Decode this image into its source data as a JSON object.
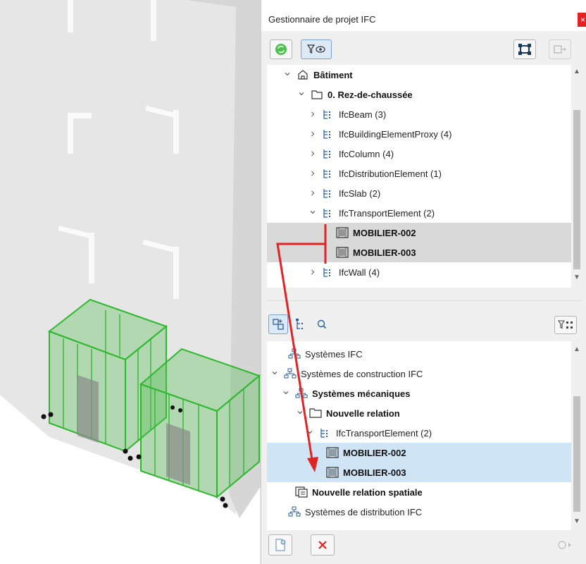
{
  "window": {
    "title": "Gestionnaire de projet IFC",
    "close_glyph": "×"
  },
  "top_toolbar": {
    "refresh_icon": "refresh-icon",
    "filter_view_icon": "filter-eye-icon",
    "structure_icon": "selection-frame-icon",
    "disabled_icon": "frame-arrow-icon"
  },
  "spatial_tree": {
    "items": [
      {
        "label": "Bâtiment",
        "bold": true,
        "expanded": true,
        "icon": "building-icon"
      },
      {
        "label": "0. Rez-de-chaussée",
        "bold": true,
        "expanded": true,
        "icon": "storey-icon"
      },
      {
        "label": "IfcBeam (3)",
        "icon": "ifc-type-icon"
      },
      {
        "label": "IfcBuildingElementProxy (4)",
        "icon": "ifc-type-icon"
      },
      {
        "label": "IfcColumn (4)",
        "icon": "ifc-type-icon"
      },
      {
        "label": "IfcDistributionElement (1)",
        "icon": "ifc-type-icon"
      },
      {
        "label": "IfcSlab (2)",
        "icon": "ifc-type-icon"
      },
      {
        "label": "IfcTransportElement (2)",
        "expanded": true,
        "icon": "ifc-type-icon"
      },
      {
        "label": "MOBILIER-002",
        "bold": true,
        "selected": true,
        "icon": "element-icon"
      },
      {
        "label": "MOBILIER-003",
        "bold": true,
        "selected": true,
        "icon": "element-icon"
      },
      {
        "label": "IfcWall (4)",
        "icon": "ifc-type-icon"
      }
    ]
  },
  "bottom_toolbar": {
    "add_icon": "add-assignment-icon",
    "hierarchy_icon": "hierarchy-icon",
    "search_icon": "search-icon",
    "filter_icon": "filter-icon"
  },
  "systems_tree": {
    "items": [
      {
        "label": "Systèmes IFC",
        "icon": "systems-icon"
      },
      {
        "label": "Systèmes de construction IFC",
        "expanded": true,
        "icon": "systems-icon"
      },
      {
        "label": "Systèmes mécaniques",
        "bold": true,
        "expanded": true,
        "icon": "systems-icon"
      },
      {
        "label": "Nouvelle relation",
        "bold": true,
        "expanded": true,
        "icon": "folder-icon"
      },
      {
        "label": "IfcTransportElement (2)",
        "expanded": true,
        "icon": "ifc-type-icon"
      },
      {
        "label": "MOBILIER-002",
        "bold": true,
        "selected": true,
        "icon": "element-icon"
      },
      {
        "label": "MOBILIER-003",
        "bold": true,
        "selected": true,
        "icon": "element-icon"
      },
      {
        "label": "Nouvelle relation spatiale",
        "bold": true,
        "icon": "spatial-relation-icon"
      },
      {
        "label": "Systèmes de distribution IFC",
        "icon": "systems-icon"
      }
    ]
  },
  "footer": {
    "new_icon": "new-document-icon",
    "delete_icon": "delete-icon",
    "more_icon": "options-icon"
  },
  "colors": {
    "accent_red": "#e02323",
    "selection_gray": "#d9d9d9",
    "selection_blue": "#cfe4f5",
    "model_green": "#2db82d"
  }
}
